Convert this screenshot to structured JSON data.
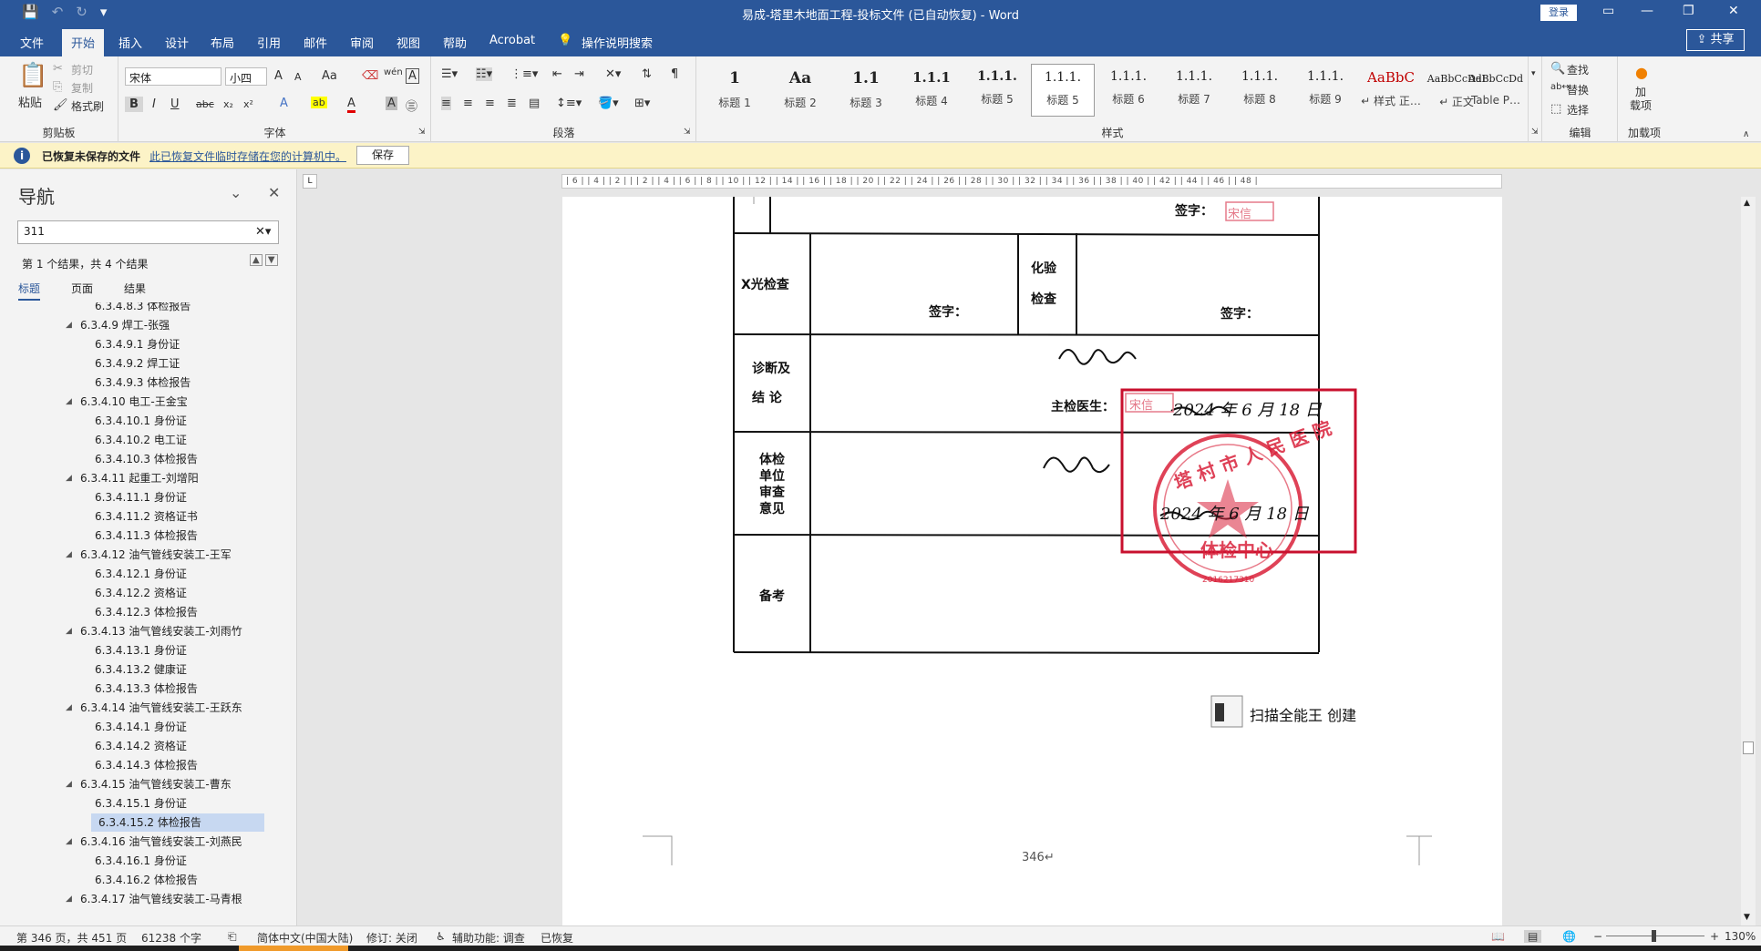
{
  "window": {
    "title": "易成-塔里木地面工程-投标文件 (已自动恢复)  -  Word",
    "login_label": "登录",
    "quick_access": {
      "save_icon": "save-icon",
      "undo_icon": "undo-icon",
      "redo_icon": "redo-icon",
      "customize_icon": "chevron-down-icon"
    }
  },
  "tabs": [
    "文件",
    "开始",
    "插入",
    "设计",
    "布局",
    "引用",
    "邮件",
    "审阅",
    "视图",
    "帮助",
    "Acrobat"
  ],
  "tell_me": "操作说明搜索",
  "share_label": "共享",
  "ribbon": {
    "clipboard": {
      "paste": "粘贴",
      "cut": "剪切",
      "copy": "复制",
      "format_painter": "格式刷",
      "label": "剪贴板"
    },
    "font": {
      "name": "宋体",
      "size": "小四",
      "label": "字体",
      "grow": "A",
      "shrink": "A",
      "case": "Aa",
      "bold": "B",
      "italic": "I",
      "underline": "U",
      "strike": "abc",
      "sub": "x₂",
      "sup": "x²",
      "effects": "A",
      "highlight": "ab",
      "color": "A",
      "char_shade": "A"
    },
    "paragraph": {
      "label": "段落"
    },
    "styles": {
      "label": "样式",
      "items": [
        {
          "preview": "1",
          "name": "标题 1"
        },
        {
          "preview": "Aa",
          "name": "标题 2"
        },
        {
          "preview": "1.1",
          "name": "标题 3"
        },
        {
          "preview": "1.1.1",
          "name": "标题 4"
        },
        {
          "preview": "1.1.1.",
          "name": "标题 5"
        },
        {
          "preview": "1.1.1.",
          "name": "标题 6"
        },
        {
          "preview": "1.1.1.",
          "name": "标题 7"
        },
        {
          "preview": "1.1.1.",
          "name": "标题 8"
        },
        {
          "preview": "1.1.1.",
          "name": "标题 9"
        },
        {
          "preview": "AaBbC",
          "name": "↵ 样式 正…"
        },
        {
          "preview": "AaBbCcDdI",
          "name": "↵ 正文"
        },
        {
          "preview": "AaBbCcDd",
          "name": "Table P…"
        }
      ]
    },
    "editing": {
      "find": "查找",
      "replace": "替换",
      "select": "选择",
      "label": "编辑"
    },
    "addins": {
      "btn": "加\n载项",
      "label": "加载项"
    }
  },
  "infobar": {
    "title": "已恢复未保存的文件",
    "message": "此已恢复文件临时存储在您的计算机中。",
    "save": "保存"
  },
  "nav": {
    "title": "导航",
    "search_value": "311",
    "results": "第 1 个结果，共 4 个结果",
    "tabs": [
      "标题",
      "页面",
      "结果"
    ],
    "items": [
      {
        "level": 3,
        "text": "6.3.4.8.3 体检报告"
      },
      {
        "level": 2,
        "text": "6.3.4.9 焊工-张强"
      },
      {
        "level": 3,
        "text": "6.3.4.9.1 身份证"
      },
      {
        "level": 3,
        "text": "6.3.4.9.2 焊工证"
      },
      {
        "level": 3,
        "text": "6.3.4.9.3 体检报告"
      },
      {
        "level": 2,
        "text": "6.3.4.10 电工-王金宝"
      },
      {
        "level": 3,
        "text": "6.3.4.10.1 身份证"
      },
      {
        "level": 3,
        "text": "6.3.4.10.2 电工证"
      },
      {
        "level": 3,
        "text": "6.3.4.10.3 体检报告"
      },
      {
        "level": 2,
        "text": "6.3.4.11 起重工-刘增阳"
      },
      {
        "level": 3,
        "text": "6.3.4.11.1 身份证"
      },
      {
        "level": 3,
        "text": "6.3.4.11.2 资格证书"
      },
      {
        "level": 3,
        "text": "6.3.4.11.3 体检报告"
      },
      {
        "level": 2,
        "text": "6.3.4.12 油气管线安装工-王军"
      },
      {
        "level": 3,
        "text": "6.3.4.12.1 身份证"
      },
      {
        "level": 3,
        "text": "6.3.4.12.2 资格证"
      },
      {
        "level": 3,
        "text": "6.3.4.12.3 体检报告"
      },
      {
        "level": 2,
        "text": "6.3.4.13 油气管线安装工-刘雨竹"
      },
      {
        "level": 3,
        "text": "6.3.4.13.1 身份证"
      },
      {
        "level": 3,
        "text": "6.3.4.13.2 健康证"
      },
      {
        "level": 3,
        "text": "6.3.4.13.3 体检报告"
      },
      {
        "level": 2,
        "text": "6.3.4.14 油气管线安装工-王跃东"
      },
      {
        "level": 3,
        "text": "6.3.4.14.1 身份证"
      },
      {
        "level": 3,
        "text": "6.3.4.14.2 资格证"
      },
      {
        "level": 3,
        "text": "6.3.4.14.3 体检报告"
      },
      {
        "level": 2,
        "text": "6.3.4.15 油气管线安装工-曹东"
      },
      {
        "level": 3,
        "text": "6.3.4.15.1 身份证"
      },
      {
        "level": 3,
        "text": "6.3.4.15.2 体检报告",
        "selected": true
      },
      {
        "level": 2,
        "text": "6.3.4.16 油气管线安装工-刘燕民"
      },
      {
        "level": 3,
        "text": "6.3.4.16.1 身份证"
      },
      {
        "level": 3,
        "text": "6.3.4.16.2 体检报告"
      },
      {
        "level": 2,
        "text": "6.3.4.17 油气管线安装工-马青根"
      }
    ]
  },
  "ruler_text": "| 6 |  | 4 |  | 2 |  |  | 2 |  | 4 |  | 6 |  | 8 |  | 10 |  | 12 |  | 14 |  | 16 |  | 18 |  | 20 |  | 22 |  | 24 |  | 26 |  | 28 |  | 30 |  | 32 |  | 34 |  | 36 |  | 38 |  | 40 |  | 42 |  | 44 |  | 46 |  | 48 |",
  "document": {
    "labels": {
      "sign_top": "签字：",
      "xray": "X光检查",
      "sign": "签字：",
      "lab_1": "化验",
      "lab_2": "检查",
      "sign2": "签字：",
      "diag_1": "诊断及",
      "diag_2": "结  论",
      "doctor": "主检医生：",
      "unit_1": "体检",
      "unit_2": "单位",
      "unit_3": "审查",
      "unit_4": "意见",
      "remark": "备考",
      "stamp_small": "宋信",
      "date_1": "2024 年 6 月 18 日",
      "date_2": "2024 年 6 月 18 日",
      "seal_top": "塔 村 市 人 民 医 院",
      "seal_bottom": "体检中心",
      "seal_code": "2016217310",
      "scanner": "扫描全能王  创建",
      "page_number": "346↵"
    }
  },
  "status": {
    "page": "第 346 页，共 451 页",
    "words": "61238 个字",
    "lang": "简体中文(中国大陆)",
    "track": "修订: 关闭",
    "access": "辅助功能: 调查",
    "recovered": "已恢复",
    "zoom": "130%"
  }
}
